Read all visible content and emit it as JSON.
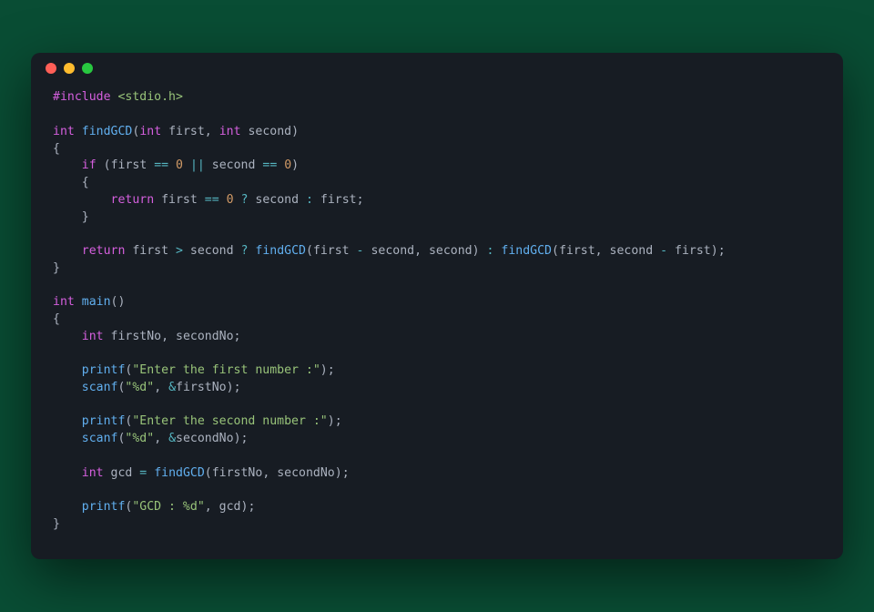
{
  "window": {
    "traffic_lights": [
      "red",
      "yellow",
      "green"
    ]
  },
  "code": {
    "language": "c",
    "tokens": [
      [
        [
          "#include ",
          "pre"
        ],
        [
          "<stdio.h>",
          "ang"
        ]
      ],
      [],
      [
        [
          "int",
          "kw"
        ],
        [
          " ",
          "plain"
        ],
        [
          "findGCD",
          "fn"
        ],
        [
          "(",
          "pun"
        ],
        [
          "int",
          "kw"
        ],
        [
          " first",
          "plain"
        ],
        [
          ",",
          "pun"
        ],
        [
          " ",
          "plain"
        ],
        [
          "int",
          "kw"
        ],
        [
          " second",
          "plain"
        ],
        [
          ")",
          "pun"
        ]
      ],
      [
        [
          "{",
          "pun"
        ]
      ],
      [
        [
          "    ",
          "plain"
        ],
        [
          "if",
          "kw"
        ],
        [
          " ",
          "plain"
        ],
        [
          "(",
          "pun"
        ],
        [
          "first ",
          "plain"
        ],
        [
          "==",
          "op"
        ],
        [
          " ",
          "plain"
        ],
        [
          "0",
          "num"
        ],
        [
          " ",
          "plain"
        ],
        [
          "||",
          "op"
        ],
        [
          " second ",
          "plain"
        ],
        [
          "==",
          "op"
        ],
        [
          " ",
          "plain"
        ],
        [
          "0",
          "num"
        ],
        [
          ")",
          "pun"
        ]
      ],
      [
        [
          "    {",
          "pun"
        ]
      ],
      [
        [
          "        ",
          "plain"
        ],
        [
          "return",
          "kw"
        ],
        [
          " first ",
          "plain"
        ],
        [
          "==",
          "op"
        ],
        [
          " ",
          "plain"
        ],
        [
          "0",
          "num"
        ],
        [
          " ",
          "plain"
        ],
        [
          "?",
          "op"
        ],
        [
          " second ",
          "plain"
        ],
        [
          ":",
          "op"
        ],
        [
          " first",
          "plain"
        ],
        [
          ";",
          "pun"
        ]
      ],
      [
        [
          "    }",
          "pun"
        ]
      ],
      [],
      [
        [
          "    ",
          "plain"
        ],
        [
          "return",
          "kw"
        ],
        [
          " first ",
          "plain"
        ],
        [
          ">",
          "op"
        ],
        [
          " second ",
          "plain"
        ],
        [
          "?",
          "op"
        ],
        [
          " ",
          "plain"
        ],
        [
          "findGCD",
          "fn"
        ],
        [
          "(",
          "pun"
        ],
        [
          "first ",
          "plain"
        ],
        [
          "-",
          "op"
        ],
        [
          " second",
          "plain"
        ],
        [
          ",",
          "pun"
        ],
        [
          " second",
          "plain"
        ],
        [
          ")",
          "pun"
        ],
        [
          " ",
          "plain"
        ],
        [
          ":",
          "op"
        ],
        [
          " ",
          "plain"
        ],
        [
          "findGCD",
          "fn"
        ],
        [
          "(",
          "pun"
        ],
        [
          "first",
          "plain"
        ],
        [
          ",",
          "pun"
        ],
        [
          " second ",
          "plain"
        ],
        [
          "-",
          "op"
        ],
        [
          " first",
          "plain"
        ],
        [
          ")",
          "pun"
        ],
        [
          ";",
          "pun"
        ]
      ],
      [
        [
          "}",
          "pun"
        ]
      ],
      [],
      [
        [
          "int",
          "kw"
        ],
        [
          " ",
          "plain"
        ],
        [
          "main",
          "fn"
        ],
        [
          "()",
          "pun"
        ]
      ],
      [
        [
          "{",
          "pun"
        ]
      ],
      [
        [
          "    ",
          "plain"
        ],
        [
          "int",
          "kw"
        ],
        [
          " firstNo",
          "plain"
        ],
        [
          ",",
          "pun"
        ],
        [
          " secondNo",
          "plain"
        ],
        [
          ";",
          "pun"
        ]
      ],
      [],
      [
        [
          "    ",
          "plain"
        ],
        [
          "printf",
          "fn"
        ],
        [
          "(",
          "pun"
        ],
        [
          "\"Enter the first number :\"",
          "str"
        ],
        [
          ")",
          "pun"
        ],
        [
          ";",
          "pun"
        ]
      ],
      [
        [
          "    ",
          "plain"
        ],
        [
          "scanf",
          "fn"
        ],
        [
          "(",
          "pun"
        ],
        [
          "\"%d\"",
          "str"
        ],
        [
          ",",
          "pun"
        ],
        [
          " ",
          "plain"
        ],
        [
          "&",
          "op"
        ],
        [
          "firstNo",
          "plain"
        ],
        [
          ")",
          "pun"
        ],
        [
          ";",
          "pun"
        ]
      ],
      [],
      [
        [
          "    ",
          "plain"
        ],
        [
          "printf",
          "fn"
        ],
        [
          "(",
          "pun"
        ],
        [
          "\"Enter the second number :\"",
          "str"
        ],
        [
          ")",
          "pun"
        ],
        [
          ";",
          "pun"
        ]
      ],
      [
        [
          "    ",
          "plain"
        ],
        [
          "scanf",
          "fn"
        ],
        [
          "(",
          "pun"
        ],
        [
          "\"%d\"",
          "str"
        ],
        [
          ",",
          "pun"
        ],
        [
          " ",
          "plain"
        ],
        [
          "&",
          "op"
        ],
        [
          "secondNo",
          "plain"
        ],
        [
          ")",
          "pun"
        ],
        [
          ";",
          "pun"
        ]
      ],
      [],
      [
        [
          "    ",
          "plain"
        ],
        [
          "int",
          "kw"
        ],
        [
          " gcd ",
          "plain"
        ],
        [
          "=",
          "op"
        ],
        [
          " ",
          "plain"
        ],
        [
          "findGCD",
          "fn"
        ],
        [
          "(",
          "pun"
        ],
        [
          "firstNo",
          "plain"
        ],
        [
          ",",
          "pun"
        ],
        [
          " secondNo",
          "plain"
        ],
        [
          ")",
          "pun"
        ],
        [
          ";",
          "pun"
        ]
      ],
      [],
      [
        [
          "    ",
          "plain"
        ],
        [
          "printf",
          "fn"
        ],
        [
          "(",
          "pun"
        ],
        [
          "\"GCD : %d\"",
          "str"
        ],
        [
          ",",
          "pun"
        ],
        [
          " gcd",
          "plain"
        ],
        [
          ")",
          "pun"
        ],
        [
          ";",
          "pun"
        ]
      ],
      [
        [
          "}",
          "pun"
        ]
      ]
    ]
  }
}
